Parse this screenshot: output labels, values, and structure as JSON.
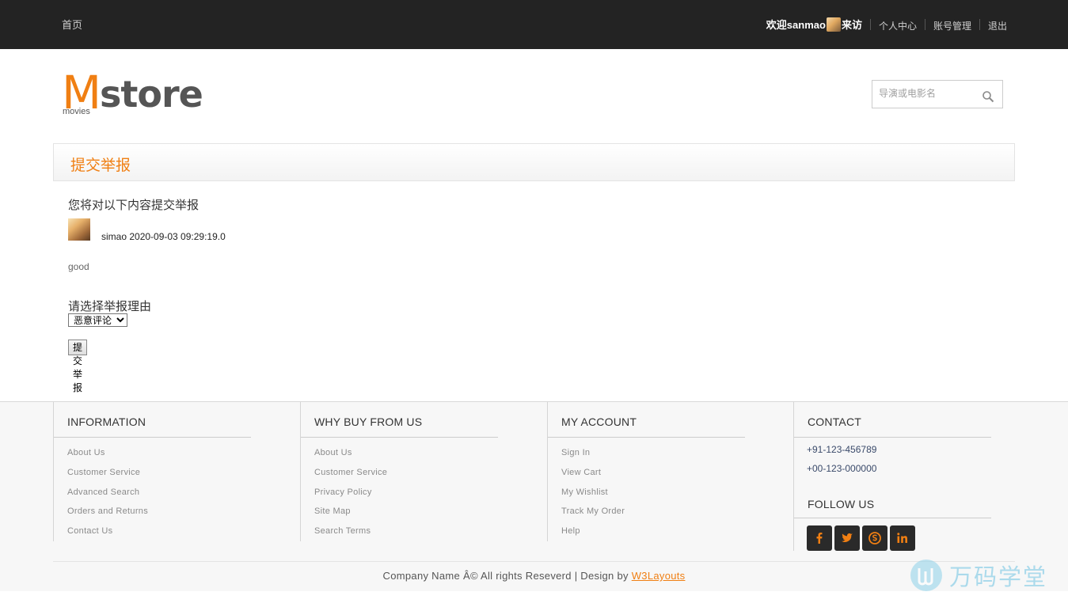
{
  "topbar": {
    "home": "首页",
    "welcome_prefix": "欢迎sanmao",
    "welcome_suffix": "来访",
    "links": [
      "个人中心",
      "账号管理",
      "退出"
    ]
  },
  "logo": {
    "m": "M",
    "store": "store",
    "sub": "movies"
  },
  "search": {
    "placeholder": "导演或电影名"
  },
  "panel": {
    "title": "提交举报"
  },
  "report": {
    "lead": "您将对以下内容提交举报",
    "author_line": "simao 2020-09-03 09:29:19.0",
    "comment": "good",
    "reason_label": "请选择举报理由",
    "reason_selected": "恶意评论",
    "submit_label": "提交举报"
  },
  "footer": {
    "columns": [
      {
        "title": "INFORMATION",
        "items": [
          "About Us",
          "Customer Service",
          "Advanced Search",
          "Orders and Returns",
          "Contact Us"
        ]
      },
      {
        "title": "WHY BUY FROM US",
        "items": [
          "About Us",
          "Customer Service",
          "Privacy Policy",
          "Site Map",
          "Search Terms"
        ]
      },
      {
        "title": "MY ACCOUNT",
        "items": [
          "Sign In",
          "View Cart",
          "My Wishlist",
          "Track My Order",
          "Help"
        ]
      }
    ],
    "contact": {
      "title": "CONTACT",
      "phones": [
        "+91-123-456789",
        "+00-123-000000"
      ],
      "follow_title": "FOLLOW US"
    },
    "social_icons": [
      "facebook-icon",
      "twitter-icon",
      "skype-icon",
      "linkedin-icon"
    ],
    "copyright_text": "Company Name Â© All rights Reseverd | Design by ",
    "copyright_link": "W3Layouts"
  },
  "watermark": "万码学堂",
  "colors": {
    "accent": "#f07f13",
    "topbar": "#232323",
    "footer_bg": "#f7f7f7"
  }
}
